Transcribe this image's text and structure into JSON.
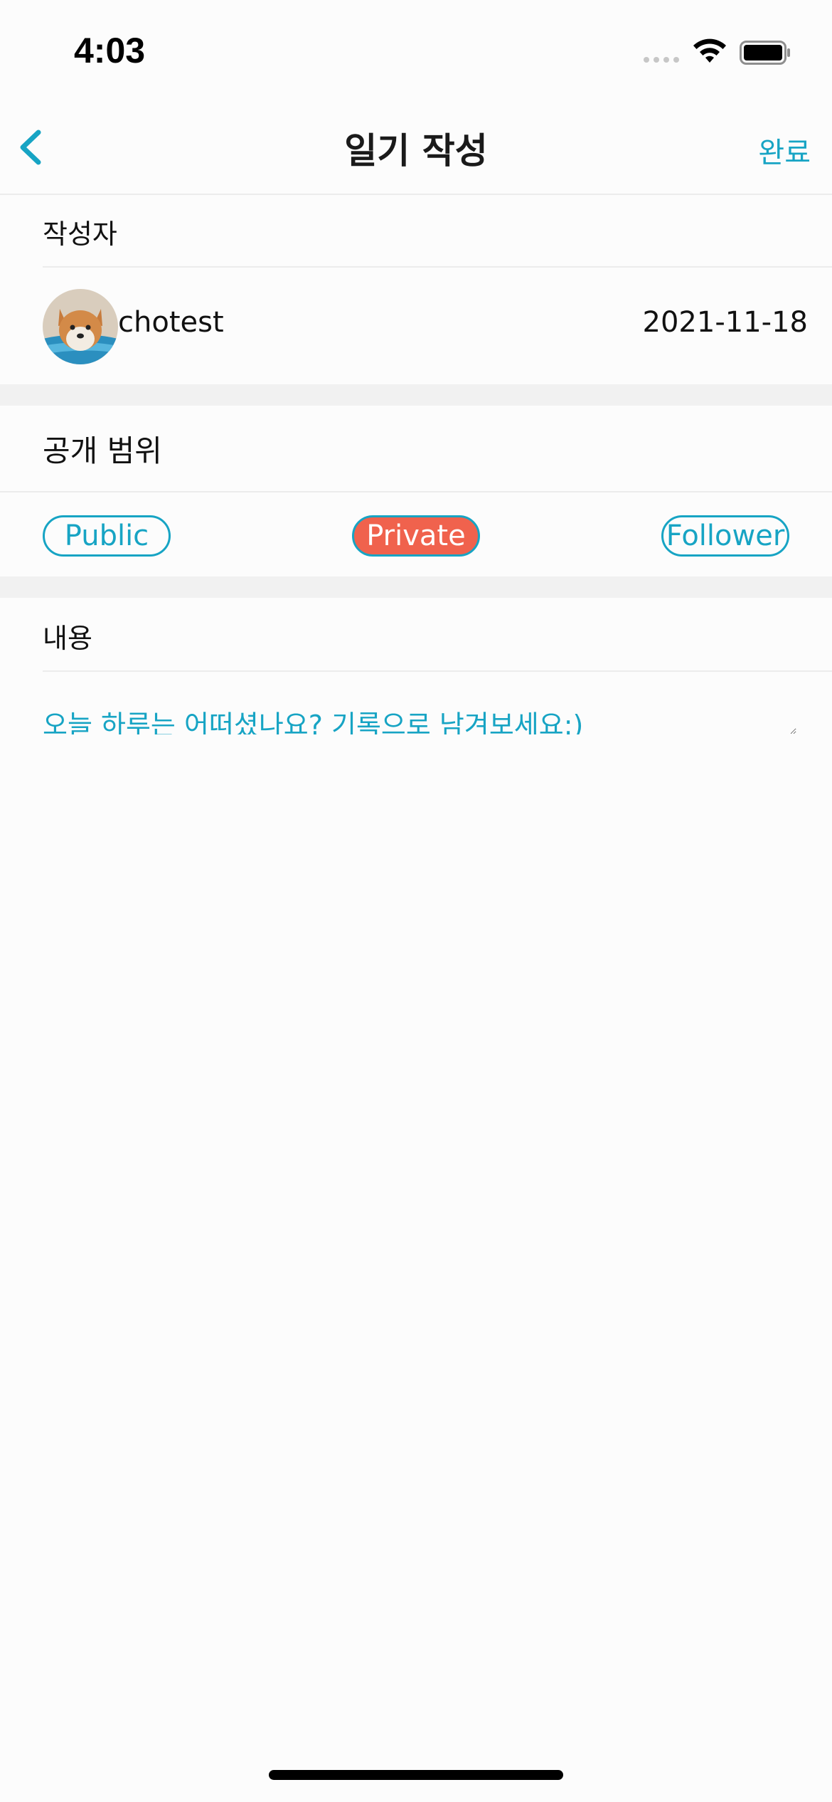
{
  "status_bar": {
    "time": "4:03",
    "signal_icon": "cellular-signal-icon",
    "wifi_icon": "wifi-icon",
    "battery_icon": "battery-icon"
  },
  "nav": {
    "back_icon": "chevron-left-icon",
    "title": "일기 작성",
    "done_label": "완료"
  },
  "author_section": {
    "label": "작성자",
    "avatar_icon": "shiba-dog-avatar",
    "username": "chotest",
    "date": "2021-11-18"
  },
  "visibility_section": {
    "label": "공개 범위",
    "options": [
      {
        "label": "Public",
        "selected": false
      },
      {
        "label": "Private",
        "selected": true
      },
      {
        "label": "Follower",
        "selected": false
      }
    ]
  },
  "content_section": {
    "label": "내용",
    "placeholder": "오늘 하루는 어떠셨나요? 기록으로 남겨보세요:)",
    "value": ""
  },
  "colors": {
    "accent": "#17a4c4",
    "selected_pill": "#f0624d",
    "background": "#fcfcfc",
    "band": "#f1f1f1"
  }
}
